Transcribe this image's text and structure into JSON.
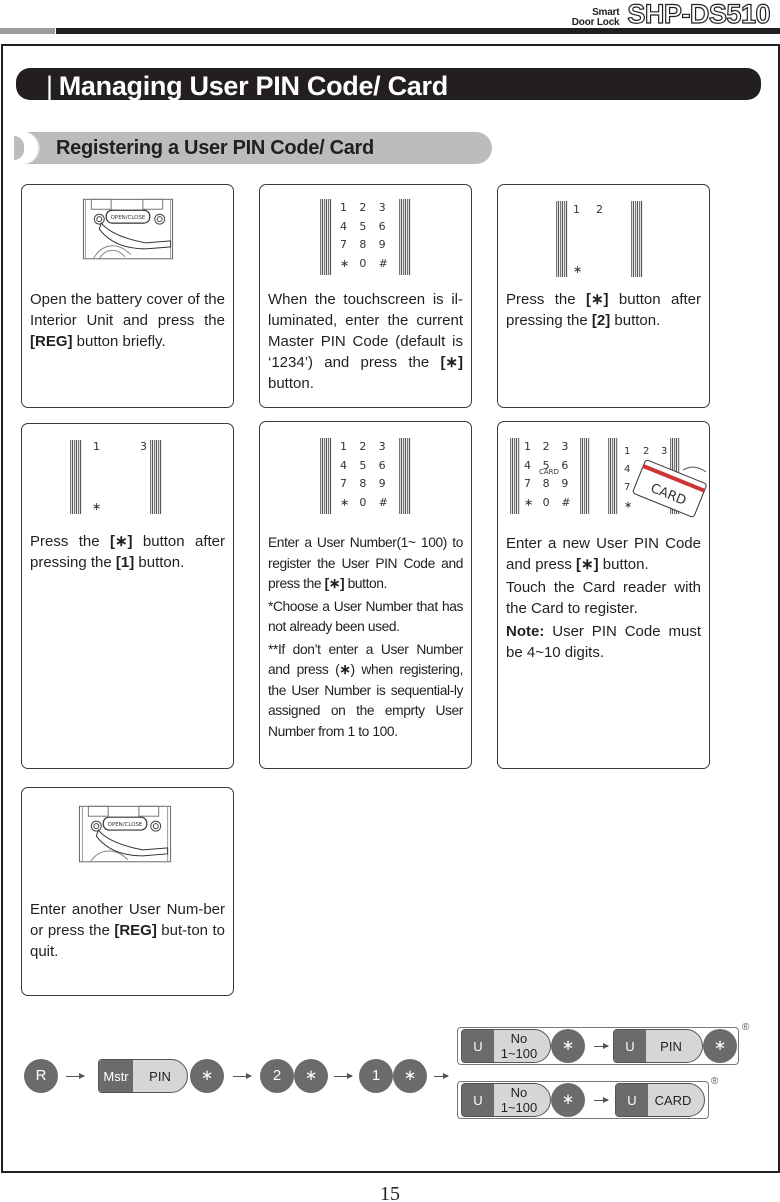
{
  "header": {
    "product_line1": "Smart",
    "product_line2": "Door Lock",
    "model": "SHP-DS510"
  },
  "section": {
    "title_pipe": "|",
    "title": "Managing User PIN Code/ Card",
    "subtitle": "Registering a User PIN Code/ Card"
  },
  "illustrations": {
    "open_close_label": "OPEN/CLOSE",
    "card_label": "CARD",
    "keypad_card_sublabel": "CARD",
    "keypad_full": [
      "1",
      "2",
      "3",
      "4",
      "5",
      "6",
      "7",
      "8",
      "9",
      "∗",
      "0",
      "#"
    ]
  },
  "steps": [
    {
      "id": 1,
      "illustration": "reg-button-press",
      "segments": [
        {
          "t": "Open the battery cover of the Interior Unit and press the "
        },
        {
          "b": "[REG]"
        },
        {
          "t": " button briefly."
        }
      ]
    },
    {
      "id": 2,
      "illustration": "full-keypad",
      "segments": [
        {
          "t": "When the touchscreen is il-luminated, enter the current Master PIN Code (default is ‘1234’) and press the "
        },
        {
          "b": "[∗]"
        },
        {
          "t": " button."
        }
      ]
    },
    {
      "id": 3,
      "illustration": "keypad-2-star",
      "segments": [
        {
          "t": "Press the "
        },
        {
          "b": "[∗]"
        },
        {
          "t": " button after pressing the "
        },
        {
          "b": "[2]"
        },
        {
          "t": " button."
        }
      ]
    },
    {
      "id": 4,
      "illustration": "keypad-1-star",
      "segments": [
        {
          "t": "Press the "
        },
        {
          "b": "[∗]"
        },
        {
          "t": " button after pressing the "
        },
        {
          "b": "[1]"
        },
        {
          "t": " button."
        }
      ]
    },
    {
      "id": 5,
      "illustration": "full-keypad",
      "paragraphs": [
        [
          {
            "t": "Enter a User Number(1~ 100) to register the User PIN Code and press the "
          },
          {
            "b": "[∗]"
          },
          {
            "t": " button."
          }
        ],
        [
          {
            "t": "*Choose a User Number that has not already been used."
          }
        ],
        [
          {
            "t": "**If don’t enter a User Number and press ("
          },
          {
            "b": "∗"
          },
          {
            "t": ") when registering, the User Number is sequential-ly assigned on the emprty User Number from 1 to 100."
          }
        ]
      ]
    },
    {
      "id": 6,
      "illustration": "keypad-card-touch",
      "paragraphs": [
        [
          {
            "t": "Enter a new User PIN Code and press "
          },
          {
            "b": "[∗]"
          },
          {
            "t": " button."
          }
        ],
        [
          {
            "t": "Touch the Card reader with the Card to register."
          }
        ],
        [
          {
            "b": "Note:"
          },
          {
            "t": " User PIN Code must be 4~10 digits."
          }
        ]
      ]
    },
    {
      "id": 7,
      "illustration": "reg-button-press",
      "segments": [
        {
          "t": "Enter another User Num-ber or press the "
        },
        {
          "b": "[REG]"
        },
        {
          "t": " but-ton to quit."
        }
      ]
    }
  ],
  "flow": {
    "reg": "R",
    "master_label": "Mstr",
    "master_value": "PIN",
    "star": "∗",
    "two": "2",
    "one": "1",
    "pin_row": {
      "user_label": "U",
      "number_value": "No\n1~100",
      "user_label2": "U",
      "value": "PIN",
      "reg_mark": "®"
    },
    "card_row": {
      "user_label": "U",
      "number_value": "No\n1~100",
      "user_label2": "U",
      "value": "CARD",
      "reg_mark": "®"
    }
  },
  "page_number": "15"
}
